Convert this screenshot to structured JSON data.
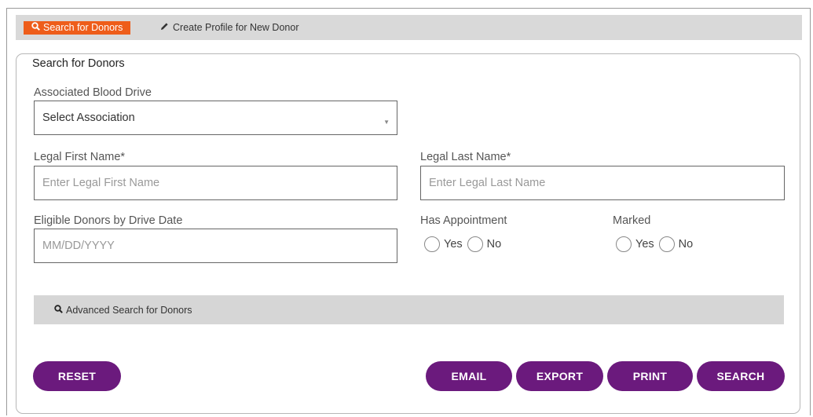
{
  "tabs": {
    "active_label": "Search for Donors",
    "create_label": "Create Profile for New Donor"
  },
  "panel": {
    "legend": "Search for Donors"
  },
  "fields": {
    "association": {
      "label": "Associated Blood Drive",
      "value": "Select Association"
    },
    "first_name": {
      "label": "Legal First Name*",
      "placeholder": "Enter Legal First Name"
    },
    "last_name": {
      "label": "Legal Last Name*",
      "placeholder": "Enter Legal Last Name"
    },
    "drive_date": {
      "label": "Eligible Donors by Drive Date",
      "placeholder": "MM/DD/YYYY"
    },
    "has_appointment": {
      "label": "Has Appointment",
      "yes": "Yes",
      "no": "No"
    },
    "marked": {
      "label": "Marked",
      "yes": "Yes",
      "no": "No"
    }
  },
  "advanced": {
    "label": "Advanced Search for Donors"
  },
  "buttons": {
    "reset": "RESET",
    "email": "EMAIL",
    "export": "EXPORT",
    "print": "PRINT",
    "search": "SEARCH"
  },
  "colors": {
    "accent_orange": "#ee5d1a",
    "button_purple": "#6b1a7d",
    "bar_gray": "#d6d6d6"
  },
  "icons": {
    "search": "search-icon",
    "pencil": "pencil-icon",
    "dropdown": "chevron-down-icon"
  }
}
